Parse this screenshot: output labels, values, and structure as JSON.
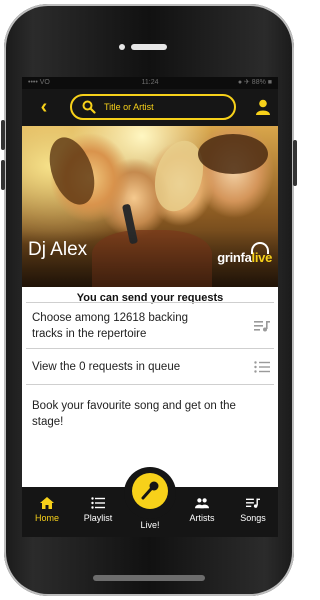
{
  "colors": {
    "accent": "#f7d11a",
    "bar": "#161616",
    "text": "#222222"
  },
  "status": {
    "left": "•••• VO",
    "time": "11:24",
    "right": "● ✈ 88% ■"
  },
  "appbar": {
    "search_placeholder": "Title or Artist",
    "back_icon": "chevron-left-icon",
    "user_icon": "user-icon"
  },
  "hero": {
    "dj_name": "Dj Alex",
    "brand_part1": "grinfa",
    "brand_part2": "live"
  },
  "main": {
    "heading": "You can send your requests",
    "rows": [
      {
        "line1": "Choose among 12618 backing",
        "line2": "tracks in the repertoire",
        "icon": "playlist-music-icon"
      },
      {
        "line1": "View the 0 requests in queue",
        "icon": "list-icon"
      },
      {
        "line1": "Book your favourite song and get on the",
        "line2": "stage!"
      }
    ]
  },
  "tabs": [
    {
      "label": "Home",
      "icon": "home-icon",
      "active": true
    },
    {
      "label": "Playlist",
      "icon": "playlist-icon"
    },
    {
      "label": "Live!",
      "icon": "microphone-icon"
    },
    {
      "label": "Artists",
      "icon": "artists-icon"
    },
    {
      "label": "Songs",
      "icon": "songs-icon"
    }
  ]
}
